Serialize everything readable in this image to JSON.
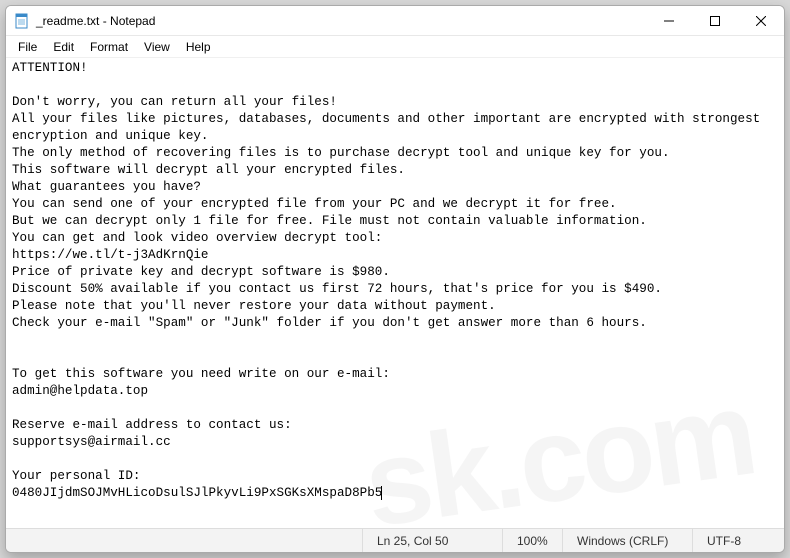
{
  "titlebar": {
    "title": "_readme.txt - Notepad"
  },
  "menu": {
    "file": "File",
    "edit": "Edit",
    "format": "Format",
    "view": "View",
    "help": "Help"
  },
  "content": "ATTENTION!\n\nDon't worry, you can return all your files!\nAll your files like pictures, databases, documents and other important are encrypted with strongest encryption and unique key.\nThe only method of recovering files is to purchase decrypt tool and unique key for you.\nThis software will decrypt all your encrypted files.\nWhat guarantees you have?\nYou can send one of your encrypted file from your PC and we decrypt it for free.\nBut we can decrypt only 1 file for free. File must not contain valuable information.\nYou can get and look video overview decrypt tool:\nhttps://we.tl/t-j3AdKrnQie\nPrice of private key and decrypt software is $980.\nDiscount 50% available if you contact us first 72 hours, that's price for you is $490.\nPlease note that you'll never restore your data without payment.\nCheck your e-mail \"Spam\" or \"Junk\" folder if you don't get answer more than 6 hours.\n\n\nTo get this software you need write on our e-mail:\nadmin@helpdata.top\n\nReserve e-mail address to contact us:\nsupportsys@airmail.cc\n\nYour personal ID:\n0480JIjdmSOJMvHLicoDsulSJlPkyvLi9PxSGKsXMspaD8Pb5",
  "status": {
    "pos": "Ln 25, Col 50",
    "zoom": "100%",
    "eol": "Windows (CRLF)",
    "enc": "UTF-8"
  }
}
